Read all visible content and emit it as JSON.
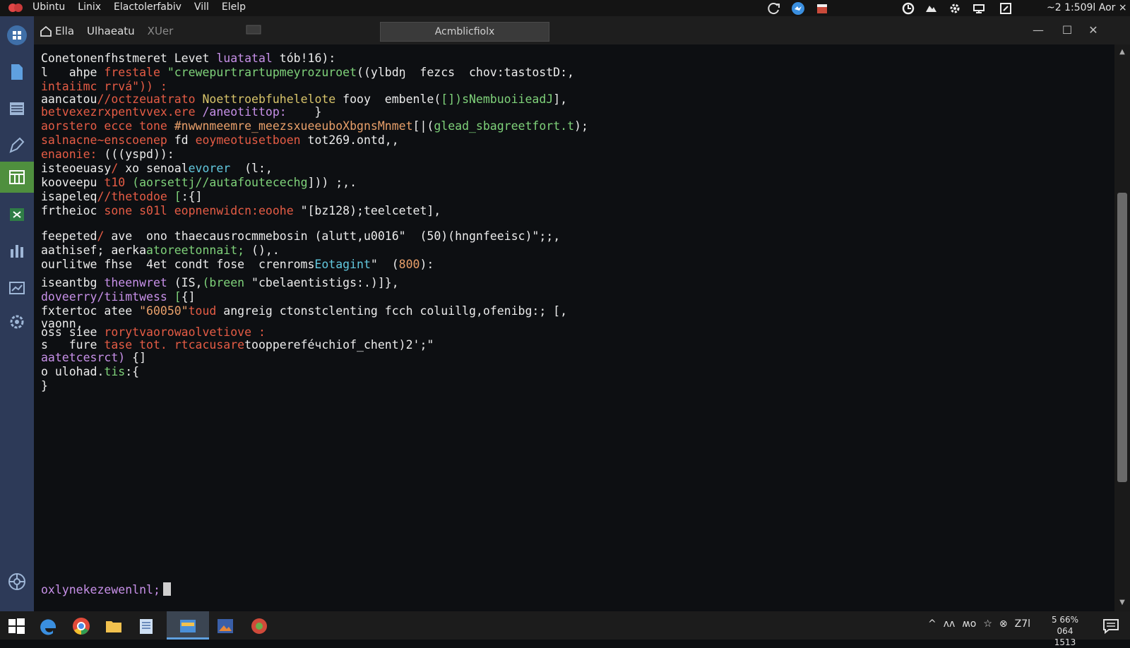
{
  "topbar": {
    "menu": [
      "Ubintu",
      "Linix",
      "Elactolerfabiv",
      "Vill",
      "Elelp"
    ],
    "clock": "~2 1:509l Aor ×"
  },
  "window": {
    "tab_home_label": "Ella",
    "tab_second_label": "Ulhaeatu",
    "tab_third_label": "XUer",
    "tab_active_label": "Acmblicfiolx",
    "minimize_glyph": "—",
    "maximize_glyph": "☐",
    "close_glyph": "✕"
  },
  "terminal": {
    "lines": [
      [
        {
          "t": "Conetonenfhstmeret Levet "
        },
        {
          "t": "luatatal",
          "c": "c-purple"
        },
        {
          "t": " tόb!16):"
        }
      ],
      [
        {
          "t": "l   ahpe "
        },
        {
          "t": "frestale ",
          "c": "c-red"
        },
        {
          "t": "\"crewepurtrartupmeyrozuroet",
          "c": "c-green"
        },
        {
          "t": "((ylbdŋ  fezcs  chov:tastostD:,"
        }
      ],
      [
        {
          "t": "intaiimc rrvá\")) :",
          "c": "c-red"
        }
      ],
      [
        {
          "t": "aancatou"
        },
        {
          "t": "//octzeuatrato ",
          "c": "c-red"
        },
        {
          "t": "Noettroebfuhelelote",
          "c": "c-yellow"
        },
        {
          "t": " fooy  embenle("
        },
        {
          "t": "[])sNembuoiieadJ",
          "c": "c-green"
        },
        {
          "t": "],"
        }
      ],
      [
        {
          "t": "betvexezrxpentvvex.ere ",
          "c": "c-red"
        },
        {
          "t": "/aneotittop:",
          "c": "c-purple"
        },
        {
          "t": "    }"
        }
      ],
      [
        {
          "t": "aorstero ecce tone ",
          "c": "c-red"
        },
        {
          "t": "#nwwnmeemre_meezsxueeuboXbgnsMnmet",
          "c": "c-orange"
        },
        {
          "t": "[|("
        },
        {
          "t": "glead_sbagreetfort.t",
          "c": "c-green"
        },
        {
          "t": ");"
        }
      ],
      [
        {
          "t": "salnacne~enscoenep ",
          "c": "c-red"
        },
        {
          "t": "fd "
        },
        {
          "t": "eoymeotusetboen ",
          "c": "c-red"
        },
        {
          "t": "tot269.ontd,,"
        }
      ],
      [
        {
          "t": "enaonie: ",
          "c": "c-red"
        },
        {
          "t": "(((yspd)):"
        }
      ],
      [
        {
          "t": "isteoeuasy"
        },
        {
          "t": "/ ",
          "c": "c-red"
        },
        {
          "t": "xo senoal"
        },
        {
          "t": "evorer",
          "c": "c-cyan"
        },
        {
          "t": "  (l:,"
        }
      ],
      [
        {
          "t": "kooveepu "
        },
        {
          "t": "t10 ",
          "c": "c-red"
        },
        {
          "t": "(aorsettj//autafoutecechg",
          "c": "c-green"
        },
        {
          "t": "])) ;,."
        }
      ],
      [
        {
          "t": "isapeleq"
        },
        {
          "t": "//thetodoe ",
          "c": "c-red"
        },
        {
          "t": "[",
          "c": "c-green"
        },
        {
          "t": ":{]"
        }
      ],
      [
        {
          "t": "frtheioc "
        },
        {
          "t": "sone s01l ",
          "c": "c-red"
        },
        {
          "t": "eopnenwidcn:eoohe ",
          "c": "c-red"
        },
        {
          "t": "\"[bz128);teelcetet],"
        }
      ],
      [
        {
          "t": "feepeted"
        },
        {
          "t": "/ ",
          "c": "c-red"
        },
        {
          "t": "ave  ono thaecausrocmmebosin (alutt,u0016\"  (50)(hngnfeeisc)\";;,"
        }
      ],
      [
        {
          "t": "aathisef; aerka"
        },
        {
          "t": "atoreetonnait;",
          "c": "c-green"
        },
        {
          "t": " (),."
        }
      ],
      [
        {
          "t": "ourlitwe fhse  4et condt fose  crenroms"
        },
        {
          "t": "Eotagint",
          "c": "c-cyan"
        },
        {
          "t": "\"  ("
        },
        {
          "t": "800",
          "c": "c-orange"
        },
        {
          "t": "):"
        }
      ],
      [
        {
          "t": "iseantbg "
        },
        {
          "t": "theenwret ",
          "c": "c-purple"
        },
        {
          "t": "(IS,"
        },
        {
          "t": "(breen ",
          "c": "c-green"
        },
        {
          "t": "\"cbelaentistigs:.)]},"
        }
      ],
      [
        {
          "t": "doveerry/tiimtwess ",
          "c": "c-purple"
        },
        {
          "t": "[",
          "c": "c-green"
        },
        {
          "t": "{]"
        }
      ],
      [
        {
          "t": "fxtertoc atee "
        },
        {
          "t": "\"60050\"",
          "c": "c-orange"
        },
        {
          "t": "toud ",
          "c": "c-red"
        },
        {
          "t": "angreig ctonstclenting fcch coluillg,ofenibg:; [,"
        }
      ],
      [
        {
          "t": "vaonn,"
        }
      ],
      [
        {
          "t": "oss siee "
        },
        {
          "t": "rorytvaorowaolvetiove :",
          "c": "c-red"
        }
      ],
      [
        {
          "t": "s   fure "
        },
        {
          "t": "tase tot. ",
          "c": "c-red"
        },
        {
          "t": "rtcacusare",
          "c": "c-red"
        },
        {
          "t": "tooppereféчchiof_chent)2';\""
        }
      ],
      [
        {
          "t": "aatetcesrct)",
          "c": "c-purple"
        },
        {
          "t": " {]"
        }
      ],
      [
        {
          "t": "o ulohad."
        },
        {
          "t": "tis",
          "c": "c-green"
        },
        {
          "t": ":{"
        }
      ],
      [
        {
          "t": "}"
        }
      ]
    ],
    "prompt": "oxlynekezewenlnl;"
  },
  "taskbar": {
    "tray_text": [
      "^",
      "ʌʌ",
      "ʍo",
      "☆",
      "⊗",
      "Z7l"
    ],
    "clock_line1": "5 66%",
    "clock_line2": "064 1513"
  }
}
